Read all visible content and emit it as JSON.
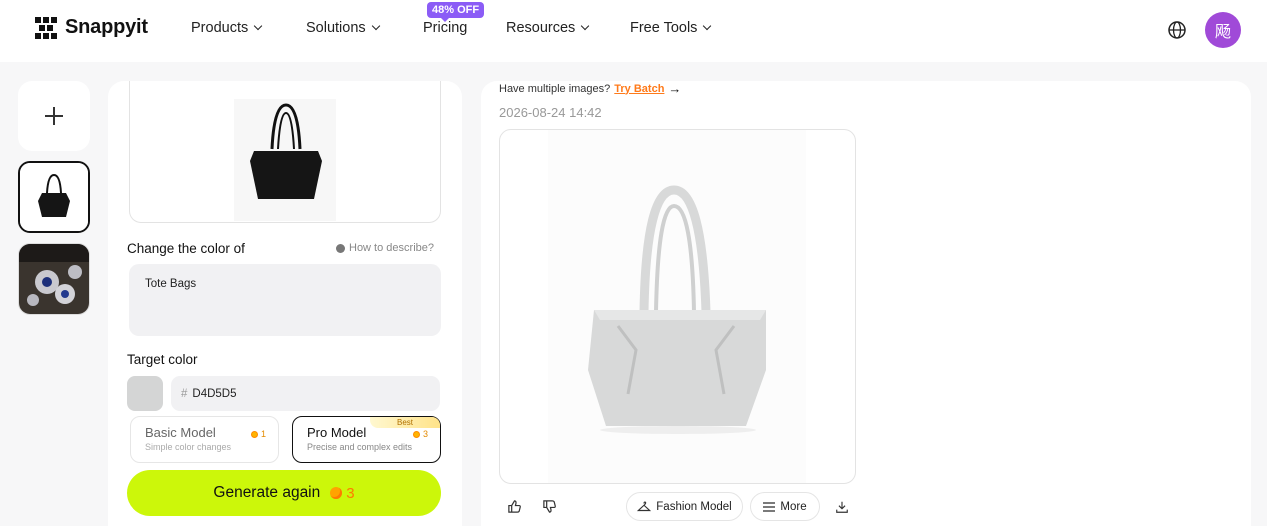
{
  "header": {
    "brand": "Snappyit",
    "nav": [
      {
        "label": "Products"
      },
      {
        "label": "Solutions"
      },
      {
        "label": "Pricing"
      },
      {
        "label": "Resources"
      },
      {
        "label": "Free Tools"
      }
    ],
    "pricing_badge": "48% OFF",
    "avatar_initial": "飏"
  },
  "rail": {
    "add_icon": "plus-icon"
  },
  "editor": {
    "change_label": "Change the color of",
    "hint": "How to describe?",
    "object_text": "Tote Bags",
    "target_label": "Target color",
    "color_hash": "#",
    "color_value": "D4D5D5",
    "swatch_color": "#d4d5d5",
    "models": {
      "basic": {
        "name": "Basic Model",
        "desc": "Simple color changes",
        "cost": "1"
      },
      "pro": {
        "name": "Pro Model",
        "desc": "Precise and complex edits",
        "cost": "3",
        "badge": "Best"
      }
    },
    "generate_label": "Generate again",
    "generate_cost": "3"
  },
  "result": {
    "batch_prompt": "Have multiple images?",
    "batch_link": "Try Batch",
    "timestamp": "2026-08-24 14:42",
    "fashion_model_label": "Fashion Model",
    "more_label": "More"
  },
  "colors": {
    "accent_lime": "#ccf70a",
    "avatar_purple": "#a04ad8",
    "promo_purple": "#8b5cf6",
    "link_orange": "#ff7a1a"
  }
}
